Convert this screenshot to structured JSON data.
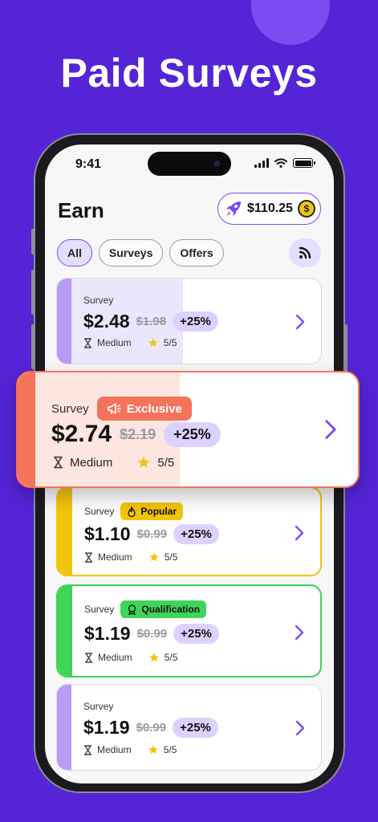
{
  "headline": "Paid Surveys",
  "status_bar": {
    "time": "9:41"
  },
  "header": {
    "title": "Earn",
    "balance": "$110.25",
    "coin_symbol": "$"
  },
  "filters": [
    {
      "label": "All",
      "active": true
    },
    {
      "label": "Surveys",
      "active": false
    },
    {
      "label": "Offers",
      "active": false
    }
  ],
  "featured": {
    "label": "Survey",
    "badge": "Exclusive",
    "price": "$2.74",
    "old_price": "$2.19",
    "bonus": "+25%",
    "difficulty": "Medium",
    "rating": "5/5",
    "accent": "#f4735a"
  },
  "cards": [
    {
      "label": "Survey",
      "badge": "",
      "price": "$2.48",
      "old_price": "$1.98",
      "bonus": "+25%",
      "difficulty": "Medium",
      "rating": "5/5",
      "accent": "#b89af7"
    },
    {
      "label": "Survey",
      "badge": "Popular",
      "price": "$1.10",
      "old_price": "$0.99",
      "bonus": "+25%",
      "difficulty": "Medium",
      "rating": "5/5",
      "accent": "#f2c40c"
    },
    {
      "label": "Survey",
      "badge": "Qualification",
      "price": "$1.19",
      "old_price": "$0.99",
      "bonus": "+25%",
      "difficulty": "Medium",
      "rating": "5/5",
      "accent": "#3fd45a"
    },
    {
      "label": "Survey",
      "badge": "",
      "price": "$1.19",
      "old_price": "$0.99",
      "bonus": "+25%",
      "difficulty": "Medium",
      "rating": "5/5",
      "accent": "#b89af7"
    }
  ],
  "icons": {
    "balance": "rocket-icon",
    "feed": "rss-icon",
    "difficulty": "hourglass-icon",
    "rating": "star-icon",
    "featured_badge": "megaphone-icon",
    "popular_badge": "fire-icon",
    "qualification_badge": "medal-icon",
    "open": "chevron-right-icon"
  },
  "colors": {
    "background": "#5424d6",
    "primary": "#7b4cf2",
    "bonus_chip": "#ddd2ff",
    "star": "#f2c40c"
  }
}
